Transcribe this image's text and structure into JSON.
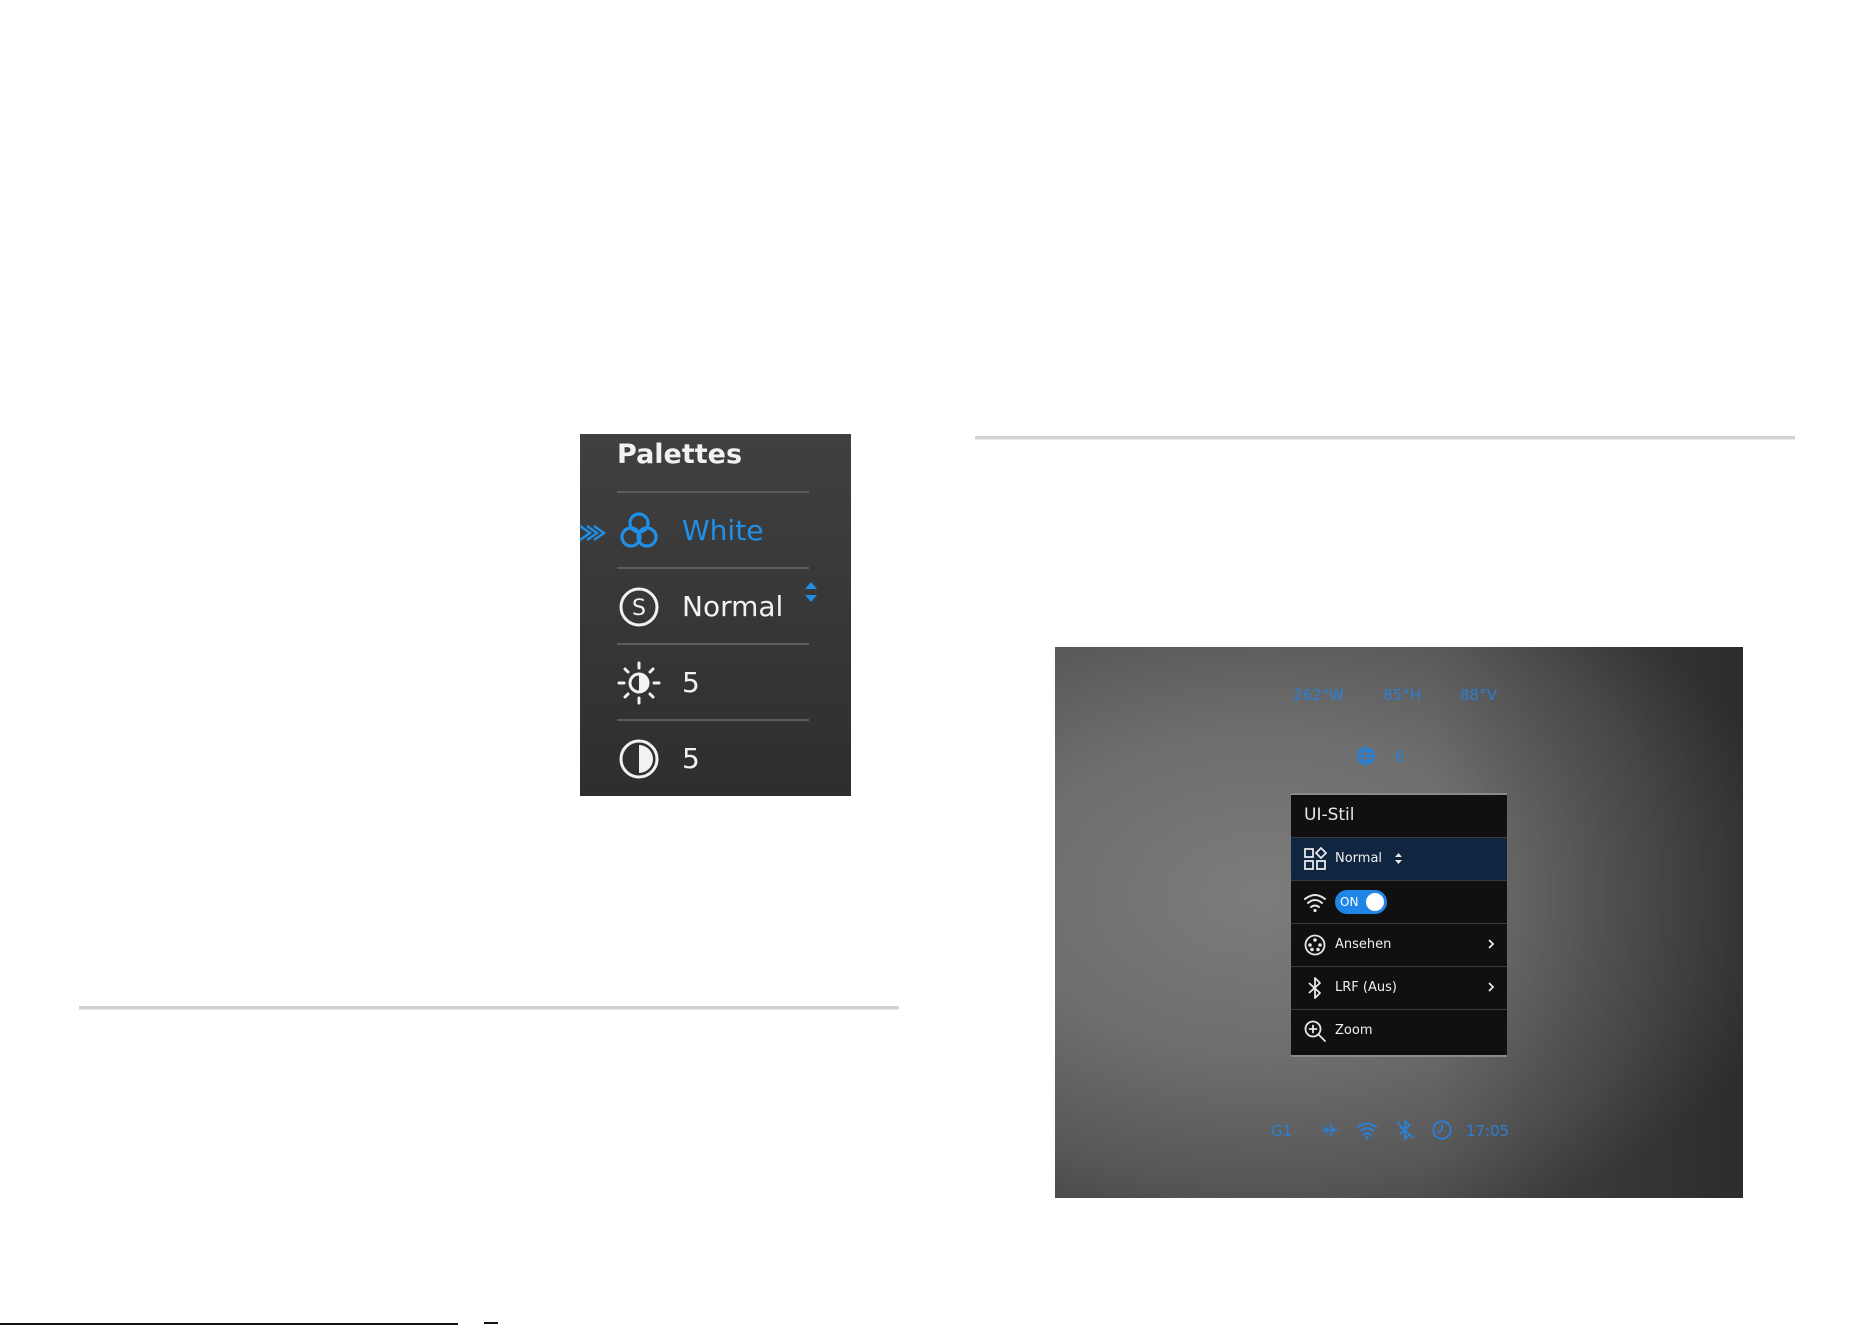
{
  "palettes_panel": {
    "title": "Palettes",
    "items": [
      {
        "icon": "palette-circles-icon",
        "label": "White",
        "selected": true
      },
      {
        "icon": "s-circle-icon",
        "label": "Normal"
      },
      {
        "icon": "brightness-icon",
        "label": "5"
      },
      {
        "icon": "contrast-icon",
        "label": "5"
      }
    ],
    "accent_color": "#1f8fe8"
  },
  "thermal_screen": {
    "top_readouts": {
      "heading": "262°W",
      "angle_h": "85°H",
      "angle_v": "88°V"
    },
    "center_indicator": {
      "icon": "globe-icon",
      "value": "6"
    },
    "menu": {
      "title": "UI-Stil",
      "items": [
        {
          "icon": "ui-style-icon",
          "label": "Normal",
          "selected": true
        },
        {
          "icon": "wifi-icon",
          "toggle_label": "ON",
          "toggle_on": true
        },
        {
          "icon": "view-icon",
          "label": "Ansehen",
          "chevron": true
        },
        {
          "icon": "bluetooth-icon",
          "label": "LRF (Aus)",
          "chevron": true
        },
        {
          "icon": "zoom-icon",
          "label": "Zoom"
        }
      ]
    },
    "status_bar": {
      "left": "G1",
      "time": "17:05"
    },
    "osd_color": "#2a7fd6"
  }
}
